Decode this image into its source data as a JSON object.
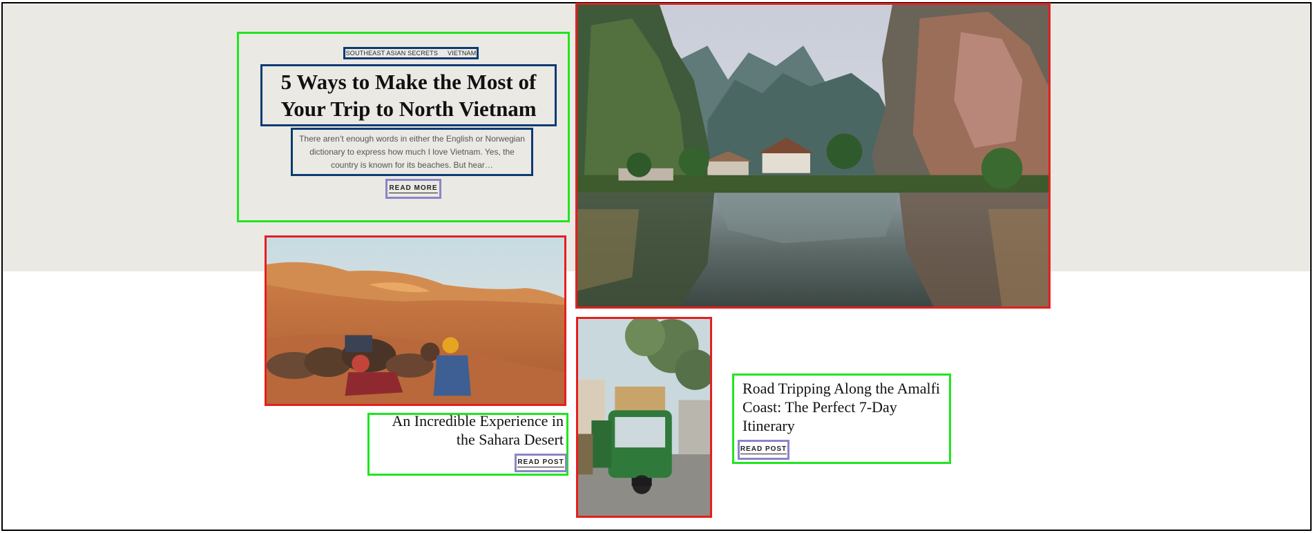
{
  "featured": {
    "tags": [
      "SOUTHEAST ASIAN SECRETS",
      "VIETNAM"
    ],
    "title": "5 Ways to Make the Most of Your Trip to North Vietnam",
    "excerpt": "There aren’t enough words in either the English or Norwegian dictionary to express how much I love Vietnam. Yes, the country is known for its beaches. But hear…",
    "read_more_label": "READ MORE"
  },
  "posts": [
    {
      "title": "An Incredible Experience in the Sahara Desert",
      "read_label": "READ POST"
    },
    {
      "title": "Road Tripping Along the Amalfi Coast: The Perfect 7-Day Itinerary",
      "read_label": "READ POST"
    }
  ],
  "colors": {
    "band_background": "#eae9e4",
    "annotation_green": "#1ee61e",
    "annotation_red": "#e61e1e",
    "annotation_blue": "#0b3a73",
    "annotation_purple": "#8a85c8"
  }
}
